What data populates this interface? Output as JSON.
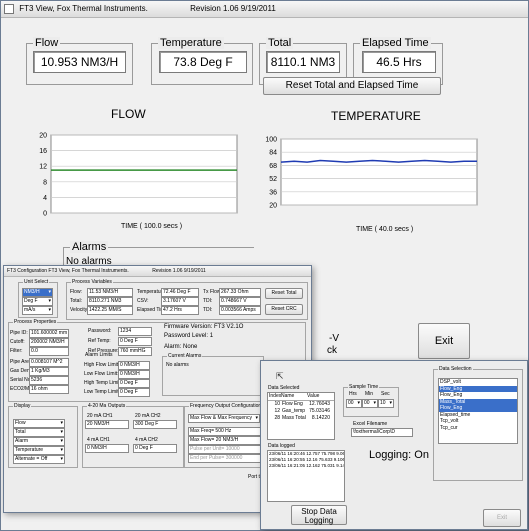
{
  "main": {
    "title": "FT3 View, Fox Thermal Instruments.",
    "revision": "Revision 1.06   9/19/2011",
    "flow": {
      "label": "Flow",
      "value": "10.953 NM3/H"
    },
    "temperature": {
      "label": "Temperature",
      "value": "73.8 Deg F"
    },
    "total": {
      "label": "Total",
      "value": "8110.1 NM3"
    },
    "elapsed": {
      "label": "Elapsed Time",
      "value": "46.5  Hrs"
    },
    "reset_button": "Reset Total and Elapsed Time",
    "alarms": {
      "label": "Alarms",
      "value": "No alarms"
    },
    "partial_labels": {
      "v": "-V",
      "ck": "ck"
    },
    "exit_button": "Exit"
  },
  "chart_data": [
    {
      "type": "line",
      "title": "FLOW",
      "xlabel": "TIME ( 100.0 secs )",
      "ylim": [
        0,
        20
      ],
      "yticks": [
        0,
        4,
        8,
        12,
        16,
        20
      ],
      "grid": true,
      "series": [
        {
          "values": [
            11,
            11,
            11,
            11,
            11,
            11,
            11,
            11,
            11,
            11
          ],
          "color": "#2e8b2e"
        }
      ]
    },
    {
      "type": "line",
      "title": "TEMPERATURE",
      "xlabel": "TIME ( 40.0 secs )",
      "ylim": [
        20,
        100
      ],
      "yticks": [
        20,
        36,
        52,
        68,
        84,
        100
      ],
      "grid": true,
      "series": [
        {
          "values": [
            72,
            73,
            72,
            74,
            73,
            72,
            73,
            74,
            73,
            72,
            73,
            74,
            73,
            72,
            73,
            73
          ],
          "color": "#1f3bb3"
        }
      ]
    }
  ],
  "config": {
    "title": "FT3 Configuration   FT3 View, Fox Thermal Instruments.",
    "revision": "Revision 1.06  9/19/2011",
    "unit_select": {
      "label": "Unit Select",
      "flow": "NM3/H",
      "temp": "Deg F",
      "extra": "mA/s"
    },
    "process_variables": {
      "label": "Process Variables",
      "rows": [
        {
          "k1": "Flow:",
          "v1": "11.53 NM3/H",
          "k2": "Temperature:",
          "v2": "72.46 Deg F",
          "k3": "Tx Flow:",
          "v3": "267.33 Ohm"
        },
        {
          "k1": "Total:",
          "v1": "8110.271 NM3",
          "k2": "CSV:",
          "v2": "3.17607 V",
          "k3": "TDI:",
          "v3": "0.748667 V"
        },
        {
          "k1": "Velocity:",
          "v1": "1422.25 MM/S",
          "k2": "Elapsed Time:",
          "v2": "47.2  Hrs",
          "k3": "TDI:",
          "v3": "0.003566 Amps"
        }
      ],
      "reset_total": "Reset Total",
      "reset_crc": "Reset CRC"
    },
    "process_properties": {
      "label": "Process Properties",
      "rows": [
        {
          "k": "Pipe ID:",
          "v": "101.600002 mm"
        },
        {
          "k": "Cutoff:",
          "v": "200002 NM3/H"
        },
        {
          "k": "Filter:",
          "v": "0.0"
        },
        {
          "k": "Pipe Area:",
          "v": "0.008107 M^2"
        },
        {
          "k": "Gas Dens:",
          "v": "1 Kg/M3"
        },
        {
          "k": "Serial No:",
          "v": "5236"
        },
        {
          "k": "ECO2/Max:",
          "v": "16 ohm"
        }
      ]
    },
    "password": {
      "k1": "Password:",
      "v1": "1234",
      "k2": "Ref Temp:",
      "v2": "0 Deg F",
      "k3": "Ref Pressure:",
      "v3": "760 mmHG"
    },
    "alarm_limits": {
      "label": "Alarm Limits",
      "rows": [
        {
          "k": "High Flow Limit:",
          "v": "0 NM3/H"
        },
        {
          "k": "Low Flow Limit:",
          "v": "0 NM3/H"
        },
        {
          "k": "High Temp Limit:",
          "v": "0 Deg F"
        },
        {
          "k": "Low Temp Limit:",
          "v": "0 Deg F"
        }
      ]
    },
    "firmware": {
      "version": "Firmware Version: FT3 V2.1O",
      "password_level": "Password Level: 1",
      "alarm": "Alarm: None"
    },
    "current_alarms": {
      "label": "Current Alarms",
      "value": "No alarms"
    },
    "display": {
      "label": "Display",
      "items": [
        "Flow",
        "Total",
        "Alarm",
        "Temperature",
        "Alternate = Off"
      ]
    },
    "outputs": {
      "label": "4-20 Ma Outputs",
      "ch1_20": "20 mA CH1",
      "ch1_20v": "20 NM3/H",
      "ch2_20": "20 mA CH2",
      "ch2_20v": "300 Deg F",
      "ch1_4": "4 mA CH1",
      "ch1_4v": "0 NM3/H",
      "ch2_4": "4 mA CH2",
      "ch2_4v": "0 Deg F"
    },
    "freq_output": {
      "label": "Frequency Output Configuration",
      "mode": "Max Flow & Max Frequency",
      "max_freq": "Max Freq= 500 Hz",
      "max_flow": "Max Flow= 20 NM3/H",
      "pulse_unit": "Pulse per Unit= 10000",
      "end_pulse": "End per Pulse= 300000"
    },
    "footer": "Port to"
  },
  "logger": {
    "data_selected": {
      "label": "Data Selected",
      "headers": [
        "Index",
        "Name",
        "Value"
      ],
      "rows": [
        [
          "10",
          "Flow Eng",
          "12.76043"
        ],
        [
          "12",
          "Gas_temp",
          "75.03146"
        ],
        [
          "28",
          "Mass Total",
          "8.14220"
        ]
      ]
    },
    "sample_time": {
      "label": "Sample Time",
      "units": [
        "Hrs",
        "Min",
        "Sec"
      ],
      "values": [
        "00",
        "00",
        "10"
      ]
    },
    "excel": {
      "label": "Excel Filename",
      "value": "\\foxthermal\\Corp\\D"
    },
    "status": "Logging: On",
    "data_logged": {
      "label": "Data logged",
      "rows": [
        "23/06/11 16:20:46  12.757  75.798  9.06",
        "23/06/11 16:20:55  12.16  75.633  9.106",
        "23/06/11 16:21:05  12.162  75.031  9.142"
      ]
    },
    "data_selection": {
      "label": "Data Selection",
      "items": [
        "DSP_volt",
        "Flow_Eng",
        "Flow_Eng",
        "Mass_Total",
        "Flow_Eng",
        "Elapsed_time",
        "Tcp_volt",
        "Tcp_cur"
      ]
    },
    "stop_button": {
      "line1": "Stop Data",
      "line2": "Logging"
    },
    "exit_button": "Exit"
  }
}
